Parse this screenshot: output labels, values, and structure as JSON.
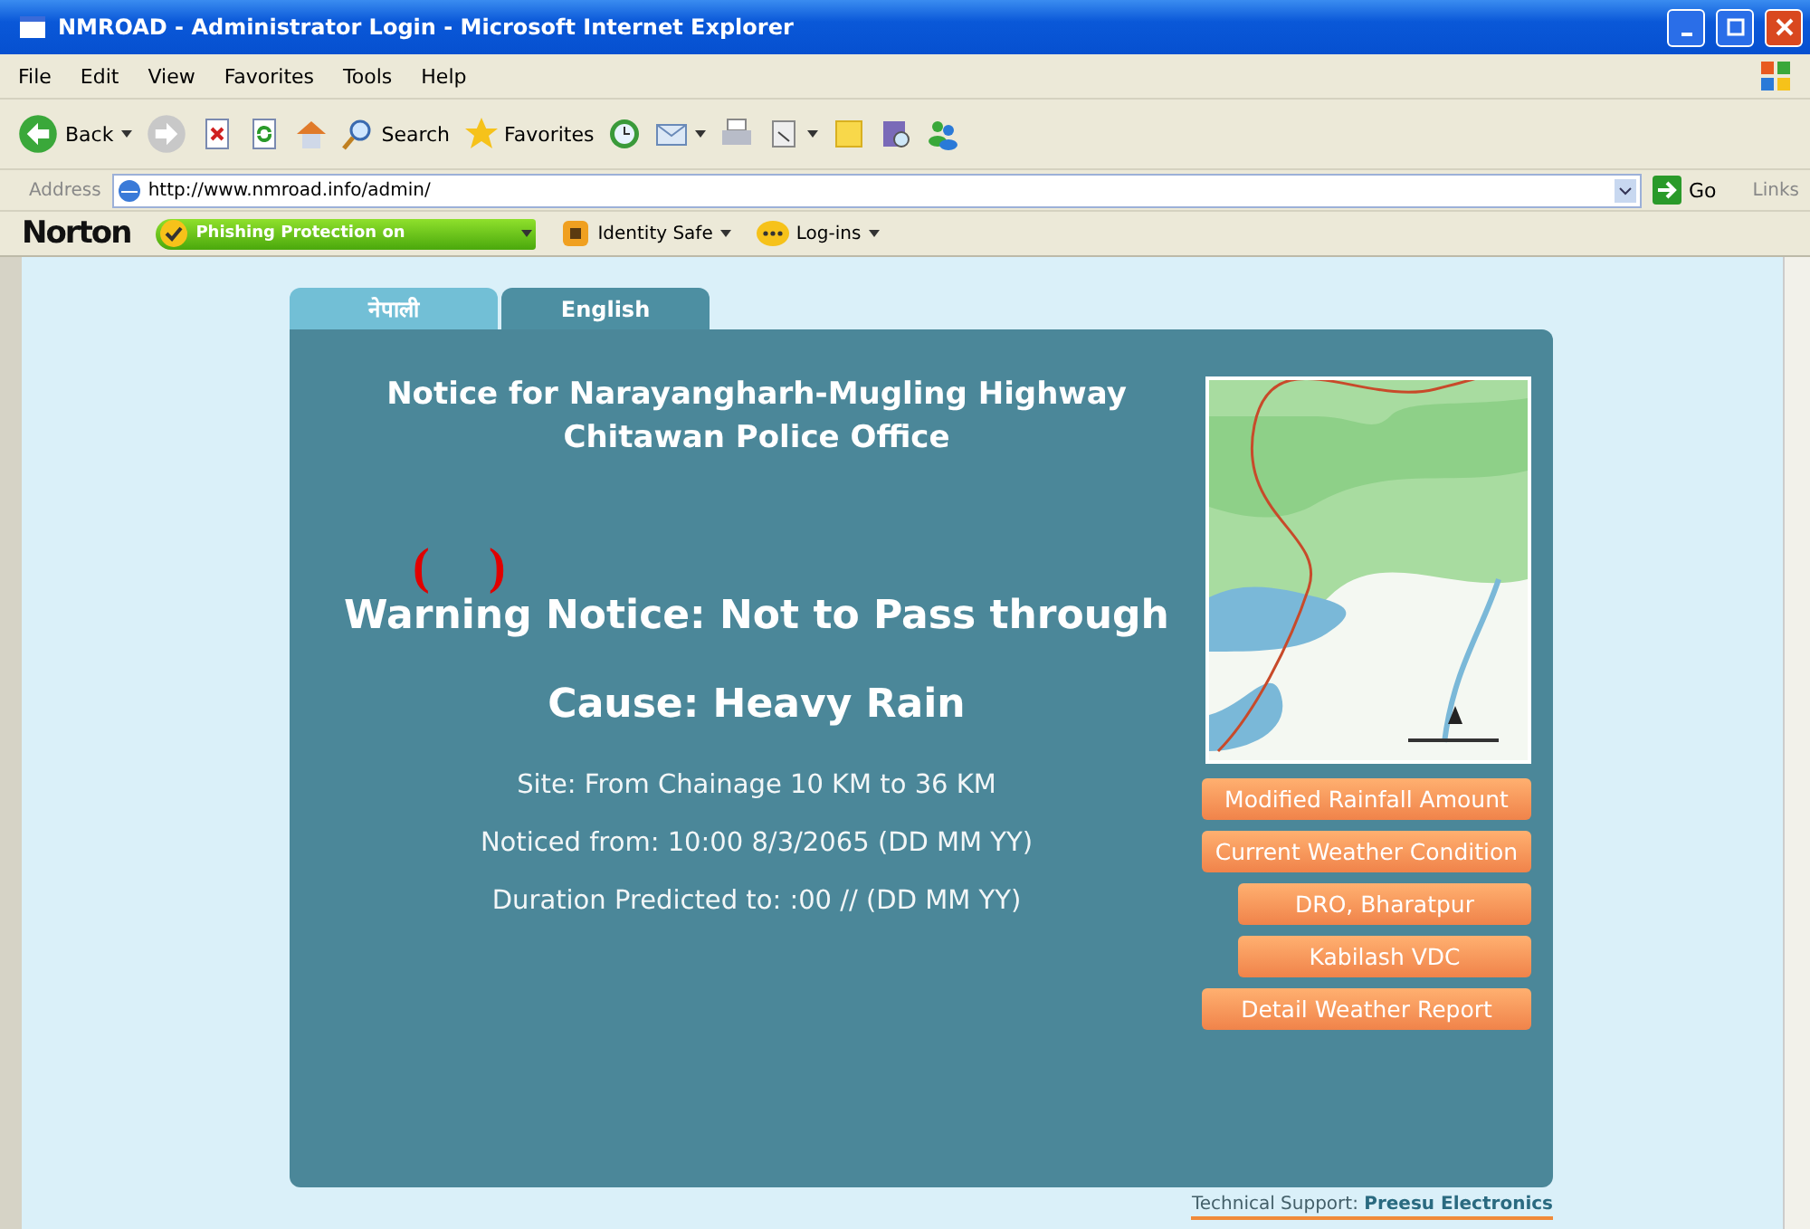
{
  "window": {
    "title": "NMROAD - Administrator Login - Microsoft Internet Explorer"
  },
  "menu": [
    "File",
    "Edit",
    "View",
    "Favorites",
    "Tools",
    "Help"
  ],
  "toolbar": [
    {
      "kind": "back",
      "label": "Back"
    },
    {
      "kind": "forward"
    },
    {
      "kind": "stop"
    },
    {
      "kind": "refresh"
    },
    {
      "kind": "home"
    },
    {
      "kind": "search",
      "label": "Search"
    },
    {
      "kind": "favorites",
      "label": "Favorites"
    },
    {
      "kind": "history"
    },
    {
      "kind": "mail"
    },
    {
      "kind": "print"
    },
    {
      "kind": "edit"
    },
    {
      "kind": "note"
    },
    {
      "kind": "research"
    },
    {
      "kind": "messenger"
    }
  ],
  "address": {
    "label": "Address",
    "value": "http://www.nmroad.info/admin/",
    "go": "Go",
    "links": "Links"
  },
  "norton": {
    "brand": "Norton",
    "phishing": "Phishing Protection on",
    "identity": "Identity Safe",
    "logins": "Log-ins"
  },
  "tabs": [
    {
      "label": "नेपाली",
      "selected": false
    },
    {
      "label": "English",
      "selected": true
    }
  ],
  "notice": {
    "title": "Notice for Narayangharh-Mugling Highway",
    "office": "Chitawan Police Office",
    "warning": "Warning Notice: Not to Pass through",
    "marks": [
      "(",
      ")"
    ],
    "cause": "Cause: Heavy Rain",
    "details": [
      "Site: From Chainage 10 KM to 36 KM",
      "Noticed from: 10:00 8/3/2065 (DD MM YY)",
      "Duration Predicted to: :00 // (DD MM YY)"
    ]
  },
  "links": [
    {
      "label": "Modified Rainfall Amount",
      "kind": "wide"
    },
    {
      "label": "Current Weather Condition",
      "kind": "wide"
    },
    {
      "label": "DRO, Bharatpur",
      "kind": "narrow"
    },
    {
      "label": "Kabilash VDC",
      "kind": "narrow"
    },
    {
      "label": "Detail Weather Report",
      "kind": "wide"
    }
  ],
  "footer": {
    "label": "Technical Support:",
    "company": "Preesu Electronics"
  }
}
